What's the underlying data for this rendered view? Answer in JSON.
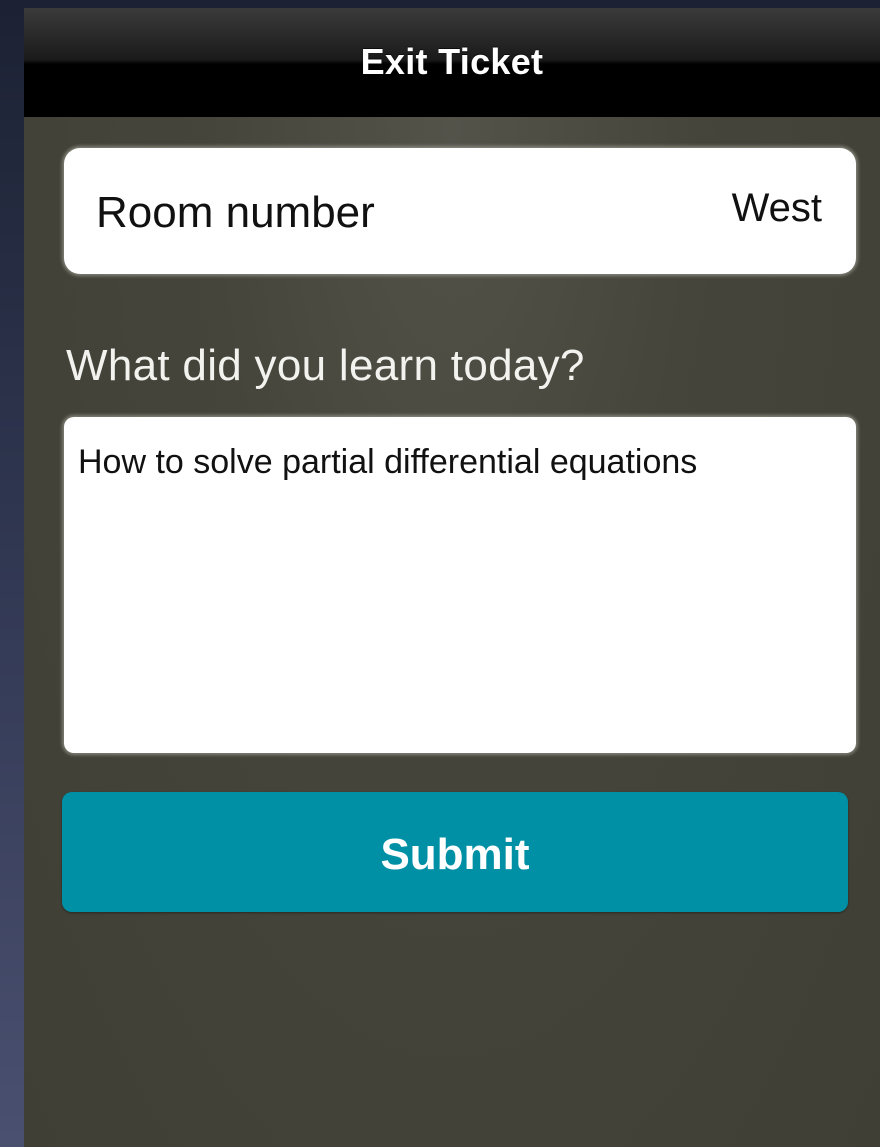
{
  "nav": {
    "title": "Exit Ticket"
  },
  "form": {
    "room": {
      "label": "Room number",
      "value": "West"
    },
    "question": {
      "label": "What did you learn today?",
      "answer": "How to solve partial differential equations"
    },
    "submit_label": "Submit"
  },
  "colors": {
    "nav_bar": "#000000",
    "background": "#45453b",
    "submit_button": "#0090a6"
  }
}
